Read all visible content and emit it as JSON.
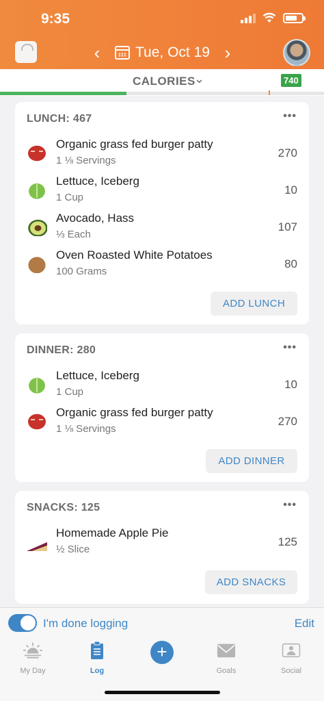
{
  "status": {
    "time": "9:35"
  },
  "header": {
    "date": "Tue, Oct 19",
    "prev_icon": "chevron-left-icon",
    "next_icon": "chevron-right-icon"
  },
  "calories_bar": {
    "label": "CALORIES",
    "badge": "740",
    "progress_fraction": 0.39,
    "progress_color": "#4cb35e"
  },
  "meals": [
    {
      "title": "LUNCH: 467",
      "more": "•••",
      "add_label": "ADD LUNCH",
      "items": [
        {
          "name": "Organic grass fed burger patty",
          "serving": "1 ⅛ Servings",
          "calories": "270",
          "icon": "steak-icon"
        },
        {
          "name": "Lettuce, Iceberg",
          "serving": "1 Cup",
          "calories": "10",
          "icon": "lettuce-icon"
        },
        {
          "name": "Avocado, Hass",
          "serving": "⅓ Each",
          "calories": "107",
          "icon": "avocado-icon"
        },
        {
          "name": "Oven Roasted White Potatoes",
          "serving": "100 Grams",
          "calories": "80",
          "icon": "potato-icon"
        }
      ]
    },
    {
      "title": "DINNER: 280",
      "more": "•••",
      "add_label": "ADD DINNER",
      "items": [
        {
          "name": "Lettuce, Iceberg",
          "serving": "1 Cup",
          "calories": "10",
          "icon": "lettuce-icon"
        },
        {
          "name": "Organic grass fed burger patty",
          "serving": "1 ⅛ Servings",
          "calories": "270",
          "icon": "steak-icon"
        }
      ]
    },
    {
      "title": "SNACKS: 125",
      "more": "•••",
      "add_label": "ADD SNACKS",
      "items": [
        {
          "name": "Homemade Apple Pie",
          "serving": "½ Slice",
          "calories": "125",
          "icon": "pie-icon"
        }
      ]
    }
  ],
  "bottom": {
    "done_logging": "I'm done logging",
    "done_logging_on": true,
    "edit": "Edit",
    "tabs": [
      {
        "label": "My Day",
        "icon": "sunrise-icon"
      },
      {
        "label": "Log",
        "icon": "clipboard-icon"
      },
      {
        "label": "",
        "icon": "plus-icon"
      },
      {
        "label": "Goals",
        "icon": "envelope-icon"
      },
      {
        "label": "Social",
        "icon": "people-icon"
      }
    ],
    "accent": "#3f86c6"
  }
}
